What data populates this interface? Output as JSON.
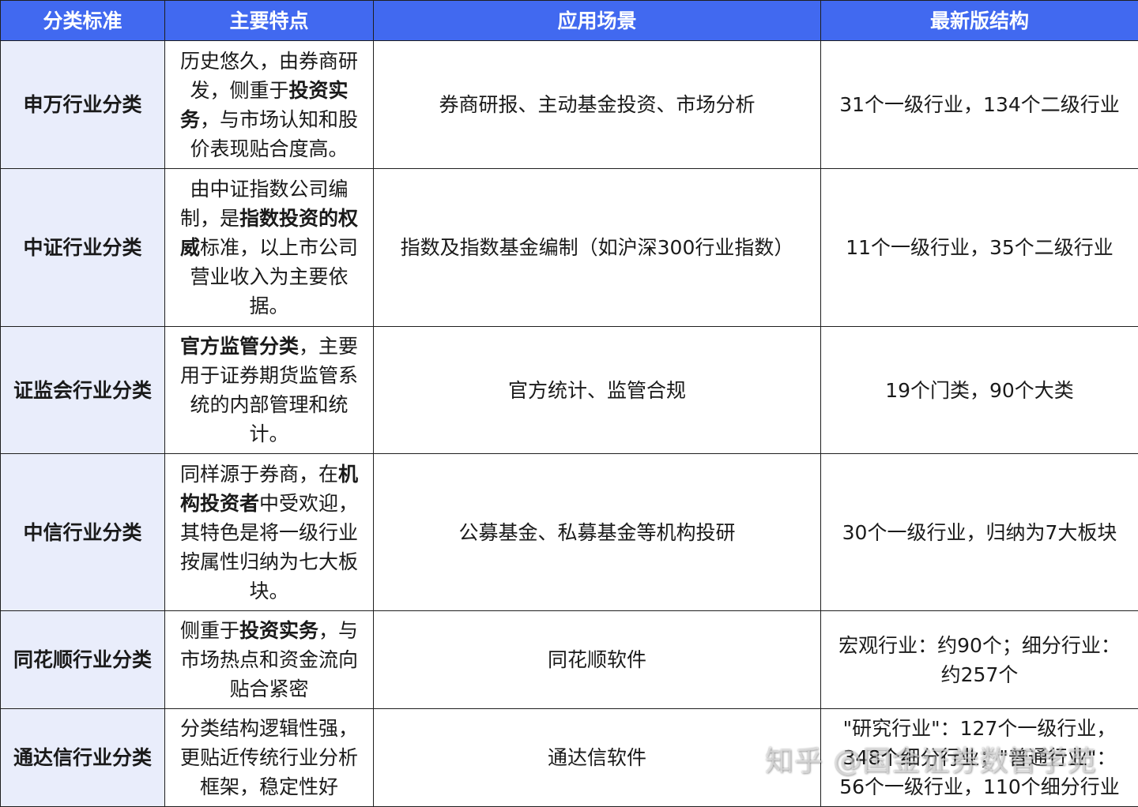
{
  "headers": [
    "分类标准",
    "主要特点",
    "应用场景",
    "最新版结构"
  ],
  "rows": [
    {
      "name": "申万行业分类",
      "feature": [
        {
          "t": "历史悠久，由券商研发，侧重于"
        },
        {
          "t": "投资实务",
          "b": true
        },
        {
          "t": "，与市场认知和股价表现贴合度高。"
        }
      ],
      "scene": "券商研报、主动基金投资、市场分析",
      "structure": [
        "31个一级行业，134个二级行业"
      ]
    },
    {
      "name": "中证行业分类",
      "feature": [
        {
          "t": "由中证指数公司编制，是"
        },
        {
          "t": "指数投资的权威",
          "b": true
        },
        {
          "t": "标准，以上市公司营业收入为主要依据。"
        }
      ],
      "scene": "指数及指数基金编制（如沪深300行业指数）",
      "structure": [
        "11个一级行业，35个二级行业"
      ]
    },
    {
      "name": "证监会行业分类",
      "feature": [
        {
          "t": "官方监管分类",
          "b": true
        },
        {
          "t": "，主要用于证券期货监管系统的内部管理和统计。"
        }
      ],
      "scene": "官方统计、监管合规",
      "structure": [
        "19个门类，90个大类"
      ]
    },
    {
      "name": "中信行业分类",
      "feature": [
        {
          "t": "同样源于券商，在"
        },
        {
          "t": "机构投资者",
          "b": true
        },
        {
          "t": "中受欢迎，其特色是将一级行业按属性归纳为七大板块。"
        }
      ],
      "scene": "公募基金、私募基金等机构投研",
      "structure": [
        "30个一级行业，归纳为7大板块"
      ]
    },
    {
      "name": "同花顺行业分类",
      "feature": [
        {
          "t": "侧重于"
        },
        {
          "t": "投资实务",
          "b": true
        },
        {
          "t": "，与市场热点和资金流向贴合紧密"
        }
      ],
      "scene": "同花顺软件",
      "structure": [
        "宏观行业：约90个；细分行业：约257个"
      ]
    },
    {
      "name": "通达信行业分类",
      "feature": [
        {
          "t": "分类结构逻辑性强，更贴近传统行业分析框架，稳定性好"
        }
      ],
      "scene": "通达信软件",
      "structure": [
        "\"研究行业\"：127个一级行业，",
        "348个细分行业；\"普通行业\"：",
        "56个一级行业，110个细分行业"
      ]
    }
  ],
  "watermark": "知乎 @国金证券数智学苑"
}
